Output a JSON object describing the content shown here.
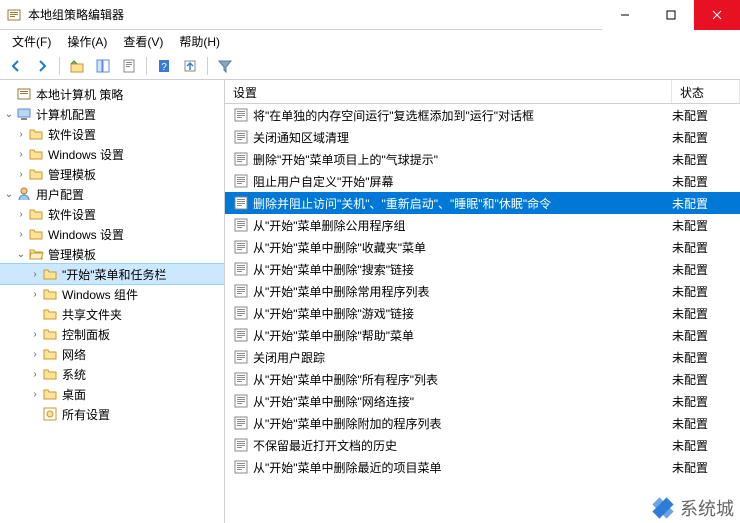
{
  "window": {
    "title": "本地组策略编辑器"
  },
  "menu": {
    "file": "文件(F)",
    "action": "操作(A)",
    "view": "查看(V)",
    "help": "帮助(H)"
  },
  "tree": {
    "root": "本地计算机 策略",
    "computer_config": "计算机配置",
    "cc_software": "软件设置",
    "cc_windows": "Windows 设置",
    "cc_templates": "管理模板",
    "user_config": "用户配置",
    "uc_software": "软件设置",
    "uc_windows": "Windows 设置",
    "uc_templates": "管理模板",
    "start_taskbar": "\"开始\"菜单和任务栏",
    "win_components": "Windows 组件",
    "shared_folders": "共享文件夹",
    "control_panel": "控制面板",
    "network": "网络",
    "system": "系统",
    "desktop": "桌面",
    "all_settings": "所有设置"
  },
  "columns": {
    "setting": "设置",
    "state": "状态"
  },
  "settings": [
    {
      "label": "将\"在单独的内存空间运行\"复选框添加到\"运行\"对话框",
      "state": "未配置"
    },
    {
      "label": "关闭通知区域清理",
      "state": "未配置"
    },
    {
      "label": "删除\"开始\"菜单项目上的\"气球提示\"",
      "state": "未配置"
    },
    {
      "label": "阻止用户自定义\"开始\"屏幕",
      "state": "未配置"
    },
    {
      "label": "删除并阻止访问\"关机\"、\"重新启动\"、\"睡眠\"和\"休眠\"命令",
      "state": "未配置",
      "selected": true
    },
    {
      "label": "从\"开始\"菜单删除公用程序组",
      "state": "未配置"
    },
    {
      "label": "从\"开始\"菜单中删除\"收藏夹\"菜单",
      "state": "未配置"
    },
    {
      "label": "从\"开始\"菜单中删除\"搜索\"链接",
      "state": "未配置"
    },
    {
      "label": "从\"开始\"菜单中删除常用程序列表",
      "state": "未配置"
    },
    {
      "label": "从\"开始\"菜单中删除\"游戏\"链接",
      "state": "未配置"
    },
    {
      "label": "从\"开始\"菜单中删除\"帮助\"菜单",
      "state": "未配置"
    },
    {
      "label": "关闭用户跟踪",
      "state": "未配置"
    },
    {
      "label": "从\"开始\"菜单中删除\"所有程序\"列表",
      "state": "未配置"
    },
    {
      "label": "从\"开始\"菜单中删除\"网络连接\"",
      "state": "未配置"
    },
    {
      "label": "从\"开始\"菜单中删除附加的程序列表",
      "state": "未配置"
    },
    {
      "label": "不保留最近打开文档的历史",
      "state": "未配置"
    },
    {
      "label": "从\"开始\"菜单中删除最近的项目菜单",
      "state": "未配置"
    }
  ],
  "watermark": "系统城"
}
